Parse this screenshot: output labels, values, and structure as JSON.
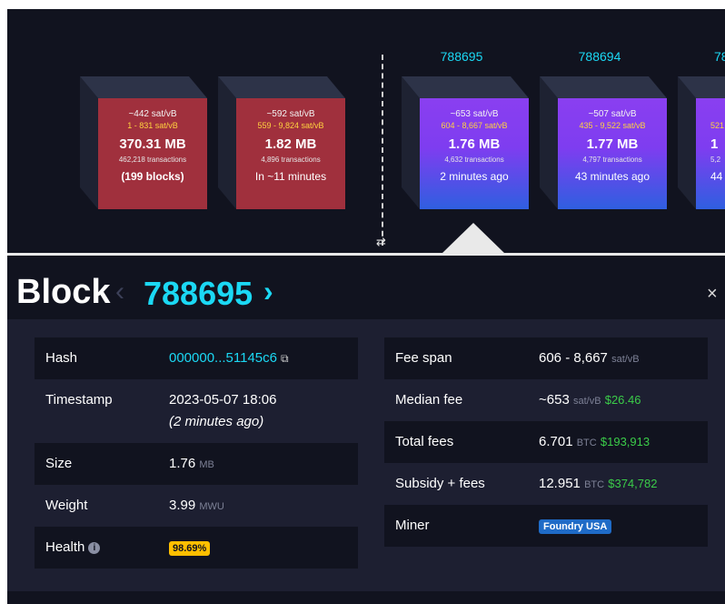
{
  "chain": {
    "mempool_blocks": [
      {
        "fee": "~442 sat/vB",
        "fee_span": "1 - 831 sat/vB",
        "size": "370.31 MB",
        "transactions": "462,218 transactions",
        "time": "(199 blocks)"
      },
      {
        "fee": "~592 sat/vB",
        "fee_span": "559 - 9,824 sat/vB",
        "size": "1.82 MB",
        "transactions": "4,896 transactions",
        "time": "In ~11 minutes"
      }
    ],
    "mined_blocks": [
      {
        "height": "788695",
        "fee": "~653 sat/vB",
        "fee_span": "604 - 8,667 sat/vB",
        "size": "1.76 MB",
        "transactions": "4,632 transactions",
        "time": "2 minutes ago"
      },
      {
        "height": "788694",
        "fee": "~507 sat/vB",
        "fee_span": "435 - 9,522 sat/vB",
        "size": "1.77 MB",
        "transactions": "4,797 transactions",
        "time": "43 minutes ago"
      },
      {
        "height": "78",
        "fee": "",
        "fee_span": "521",
        "size": "1",
        "transactions": "5,2",
        "time": "44"
      }
    ],
    "swap_icon": "⇄"
  },
  "header": {
    "title": "Block",
    "prev_icon": "‹",
    "number": "788695",
    "next_icon": "›",
    "close_icon": "×"
  },
  "details": {
    "hash_label": "Hash",
    "hash_value": "000000...51145c6",
    "timestamp_label": "Timestamp",
    "timestamp_value": "2023-05-07 18:06",
    "timestamp_ago": "(2 minutes ago)",
    "size_label": "Size",
    "size_value": "1.76",
    "size_unit": "MB",
    "weight_label": "Weight",
    "weight_value": "3.99",
    "weight_unit": "MWU",
    "health_label": "Health",
    "health_value": "98.69%",
    "fee_span_label": "Fee span",
    "fee_span_value": "606 - 8,667",
    "fee_span_unit": "sat/vB",
    "median_fee_label": "Median fee",
    "median_fee_value": "~653",
    "median_fee_unit": "sat/vB",
    "median_fee_usd": "$26.46",
    "total_fees_label": "Total fees",
    "total_fees_value": "6.701",
    "total_fees_unit": "BTC",
    "total_fees_usd": "$193,913",
    "subsidy_label": "Subsidy + fees",
    "subsidy_value": "12.951",
    "subsidy_unit": "BTC",
    "subsidy_usd": "$374,782",
    "miner_label": "Miner",
    "miner_value": "Foundry USA"
  },
  "colors": {
    "background": "#11131f",
    "panel": "#1d1f31",
    "accent": "#1bd8f4",
    "mempool_block": "#a0303d",
    "mined_block_top": "#8a3ff0",
    "mined_block_bottom": "#2f5fe0",
    "usd_green": "#3bcc49",
    "health_badge": "#ffbf00",
    "miner_badge": "#1f6bc7"
  }
}
